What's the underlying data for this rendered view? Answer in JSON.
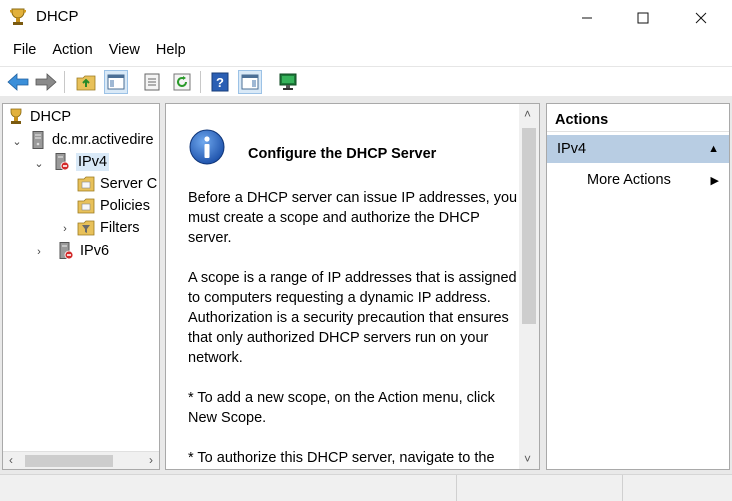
{
  "window": {
    "title": "DHCP",
    "minimize_glyph": "—",
    "maximize_glyph": "☐",
    "close_glyph": "✕"
  },
  "menu": [
    "File",
    "Action",
    "View",
    "Help"
  ],
  "toolbar": {
    "buttons": [
      "back-arrow-icon",
      "forward-arrow-icon",
      "up-folder-icon",
      "show-hide-tree-icon",
      "properties-icon",
      "refresh-icon",
      "help-icon",
      "show-hide-action-pane-icon",
      "monitor-icon"
    ]
  },
  "tree": {
    "root": "DHCP",
    "server": "dc.mr.activedire",
    "ipv4": "IPv4",
    "server_options": "Server C",
    "policies": "Policies",
    "filters": "Filters",
    "ipv6": "IPv6"
  },
  "middle": {
    "title": "Configure the DHCP Server",
    "paragraphs": [
      "Before a DHCP server can issue IP addresses, you must create a scope and authorize the DHCP server.",
      "A scope is a range of IP addresses that is assigned to computers requesting a dynamic IP address. Authorization is a security precaution that ensures that only authorized DHCP servers run on your network.",
      "* To add a new scope, on the Action menu, click New Scope.",
      "* To authorize this DHCP server, navigate to the"
    ]
  },
  "actions": {
    "header": "Actions",
    "group": "IPv4",
    "items": [
      "More Actions"
    ]
  },
  "colors": {
    "selection": "#d9e9f7",
    "action_group": "#b8cde3",
    "frame": "#e9e9e9"
  }
}
